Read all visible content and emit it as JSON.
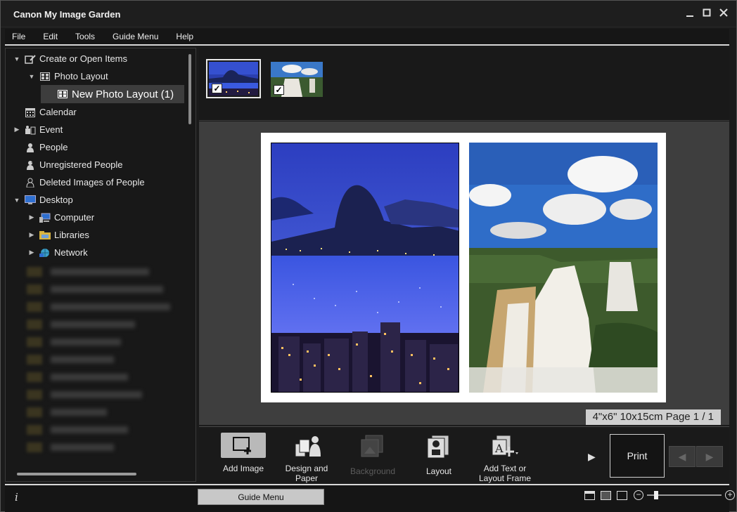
{
  "app": {
    "title": "Canon My Image Garden"
  },
  "window_controls": {
    "minimize": "_",
    "maximize": "□",
    "close": "✕"
  },
  "menu": [
    "File",
    "Edit",
    "Tools",
    "Guide Menu",
    "Help"
  ],
  "tree": {
    "items": [
      {
        "label": "Create or Open Items",
        "icon": "create-items-icon",
        "expanded": true
      },
      {
        "label": "Photo Layout",
        "icon": "photo-layout-icon",
        "expanded": true
      },
      {
        "label": "New Photo Layout (1)",
        "icon": "photo-layout-icon",
        "selected": true
      },
      {
        "label": "Calendar",
        "icon": "calendar-icon"
      },
      {
        "label": "Event",
        "icon": "event-icon",
        "expanded": false
      },
      {
        "label": "People",
        "icon": "person-icon"
      },
      {
        "label": "Unregistered People",
        "icon": "unregistered-person-icon"
      },
      {
        "label": "Deleted Images of People",
        "icon": "deleted-person-icon"
      },
      {
        "label": "Desktop",
        "icon": "desktop-icon",
        "expanded": true
      },
      {
        "label": "Computer",
        "icon": "computer-icon",
        "expanded": false
      },
      {
        "label": "Libraries",
        "icon": "libraries-icon",
        "expanded": false
      },
      {
        "label": "Network",
        "icon": "network-icon",
        "expanded": false
      }
    ]
  },
  "thumbnails": [
    {
      "name": "rio-night",
      "checked": true,
      "selected": true
    },
    {
      "name": "waterfall",
      "checked": true,
      "selected": false
    }
  ],
  "canvas": {
    "page_info": "4\"x6\" 10x15cm Page 1 / 1"
  },
  "toolbar": {
    "add_image": "Add Image",
    "design_paper": "Design and Paper",
    "background": "Background",
    "layout": "Layout",
    "add_text": "Add Text or Layout Frame",
    "more": "▶",
    "print": "Print",
    "prev": "◀",
    "next": "▶"
  },
  "status": {
    "info": "i",
    "guide_menu": "Guide Menu",
    "zoom_out": "−",
    "zoom_in": "+",
    "zoom_level": 0.1
  }
}
